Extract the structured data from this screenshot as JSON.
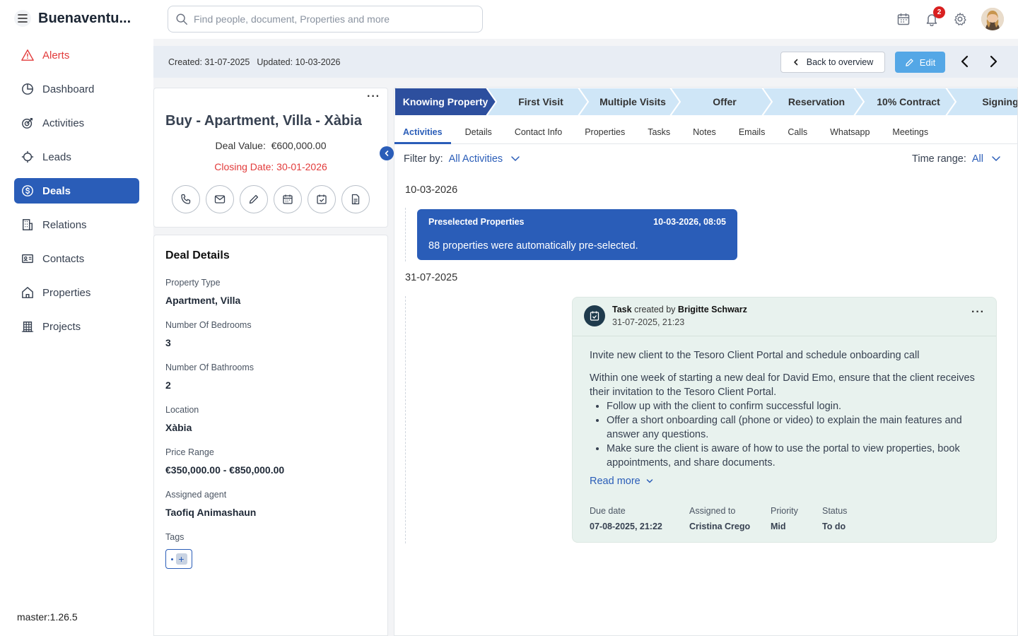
{
  "app": {
    "title": "Buenaventura",
    "title_display": "Buenaventu...",
    "version": "master:1.26.5"
  },
  "sidebar": {
    "items": [
      {
        "label": "Alerts",
        "icon": "alert-icon"
      },
      {
        "label": "Dashboard",
        "icon": "dashboard-icon"
      },
      {
        "label": "Activities",
        "icon": "activities-icon"
      },
      {
        "label": "Leads",
        "icon": "leads-icon"
      },
      {
        "label": "Deals",
        "icon": "deals-icon"
      },
      {
        "label": "Relations",
        "icon": "relations-icon"
      },
      {
        "label": "Contacts",
        "icon": "contacts-icon"
      },
      {
        "label": "Properties",
        "icon": "properties-icon"
      },
      {
        "label": "Projects",
        "icon": "projects-icon"
      }
    ]
  },
  "search": {
    "placeholder": "Find people, document, Properties and more",
    "value": ""
  },
  "header": {
    "notification_count": "2"
  },
  "infobar": {
    "created": "Created: 31-07-2025",
    "updated": "Updated: 10-03-2026",
    "back_label": "Back to overview",
    "edit_label": "Edit"
  },
  "deal": {
    "title": "Buy - Apartment, Villa - Xàbia",
    "value_label": "Deal Value:",
    "value": "€600,000.00",
    "closing_label": "Closing Date:",
    "closing": "30-01-2026"
  },
  "details": {
    "heading": "Deal Details",
    "fields": [
      {
        "label": "Property Type",
        "value": "Apartment, Villa"
      },
      {
        "label": "Number Of Bedrooms",
        "value": "3"
      },
      {
        "label": "Number Of Bathrooms",
        "value": "2"
      },
      {
        "label": "Location",
        "value": "Xàbia"
      },
      {
        "label": "Price Range",
        "value": "€350,000.00 - €850,000.00"
      },
      {
        "label": "Assigned agent",
        "value": "Taofiq Animashaun"
      }
    ],
    "tags_label": "Tags"
  },
  "stages": [
    "Knowing Property",
    "First Visit",
    "Multiple Visits",
    "Offer",
    "Reservation",
    "10% Contract",
    "Signing"
  ],
  "tabs": [
    "Activities",
    "Details",
    "Contact Info",
    "Properties",
    "Tasks",
    "Notes",
    "Emails",
    "Calls",
    "Whatsapp",
    "Meetings"
  ],
  "filter": {
    "label": "Filter by:",
    "value": "All Activities",
    "time_label": "Time range:",
    "time_value": "All"
  },
  "timeline": {
    "date1": "10-03-2026",
    "preselected": {
      "title": "Preselected Properties",
      "datetime": "10-03-2026, 08:05",
      "body": "88 properties were automatically pre-selected."
    },
    "date2": "31-07-2025",
    "task": {
      "kind": "Task",
      "created_by_label": "created by",
      "author": "Brigitte Schwarz",
      "datetime": "31-07-2025, 21:23",
      "title": "Invite new client to the Tesoro Client Portal and schedule onboarding call",
      "intro": "Within one week of starting a new deal for David Emo, ensure that the client receives their invitation to the Tesoro Client Portal.",
      "bullets": [
        "Follow up with the client to confirm successful login.",
        "Offer a short onboarding call (phone or video) to explain the main features and answer any questions.",
        "Make sure the client is aware of how to use the portal to view properties, book appointments, and share documents."
      ],
      "read_more": "Read more",
      "meta": [
        {
          "label": "Due date",
          "value": "07-08-2025, 21:22"
        },
        {
          "label": "Assigned to",
          "value": "Cristina Crego"
        },
        {
          "label": "Priority",
          "value": "Mid"
        },
        {
          "label": "Status",
          "value": "To do"
        }
      ]
    }
  },
  "colors": {
    "primary": "#2a5db8",
    "alert": "#e23b3b",
    "stage_active": "#2d4f9e",
    "stage_inactive": "#cfe6f7",
    "task_bg": "#e8f2ee",
    "edit_button": "#54a7e6"
  }
}
